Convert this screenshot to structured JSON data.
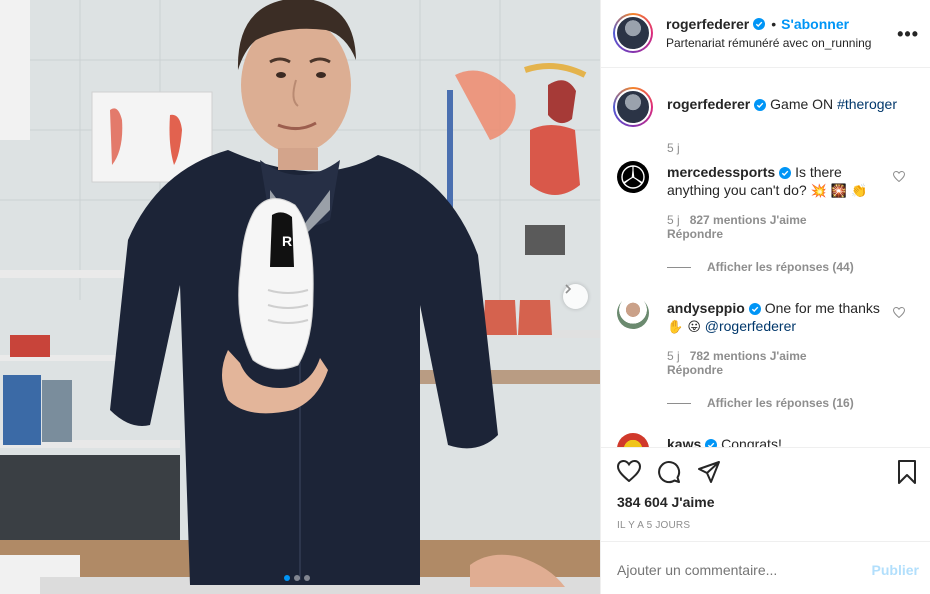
{
  "post": {
    "author": "rogerfederer",
    "follow_label": "S'abonner",
    "separator": "•",
    "partnership": "Partenariat rémunéré avec on_running",
    "more_label": "•••",
    "carousel": {
      "slides": 3,
      "active_slide": 1
    }
  },
  "caption": {
    "username": "rogerfederer",
    "text": "Game ON",
    "hashtag": "#theroger",
    "time": "5 j"
  },
  "comments": [
    {
      "username": "mercedessports",
      "text": "Is there anything you can't do?",
      "emojis": "💥 🎇 👏",
      "time": "5 j",
      "likes": "827 mentions J'aime",
      "reply": "Répondre",
      "replies": "Afficher les réponses (44)"
    },
    {
      "username": "andyseppio",
      "text": "One for me thanks",
      "emojis": "✋ 😛",
      "mention": "@rogerfederer",
      "time": "5 j",
      "likes": "782 mentions J'aime",
      "reply": "Répondre",
      "replies": "Afficher les réponses (16)"
    },
    {
      "username": "kaws",
      "text": "Congrats!"
    }
  ],
  "actions": {
    "likes": "384 604 J'aime",
    "date": "IL Y A 5 JOURS"
  },
  "add_comment": {
    "placeholder": "Ajouter un commentaire...",
    "publish": "Publier"
  },
  "colors": {
    "accent": "#0095f6",
    "publish_disabled": "#b2dffc",
    "muted": "#8e8e8e",
    "text": "#262626"
  }
}
